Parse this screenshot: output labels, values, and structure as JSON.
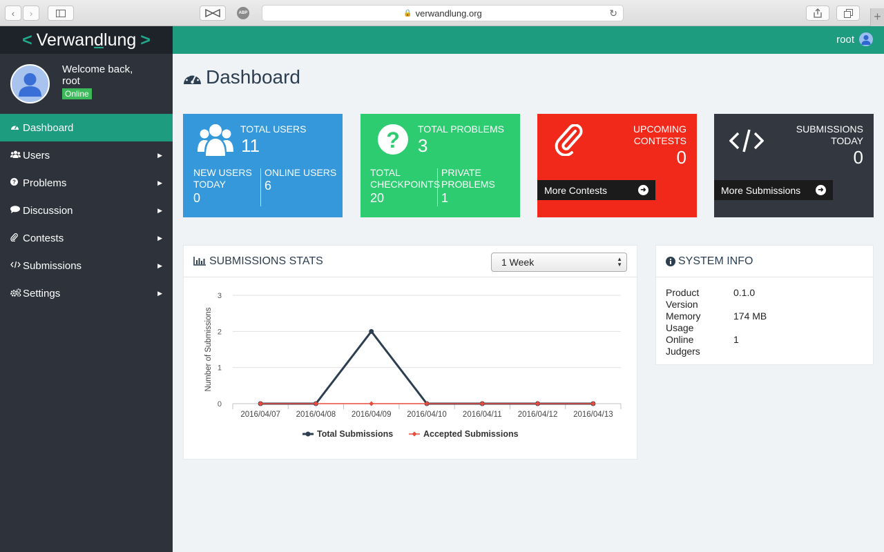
{
  "browser": {
    "url": "verwandlung.org"
  },
  "sidebar": {
    "logo": {
      "left": "<",
      "text_a": "Verwan",
      "text_u": "d",
      "text_b": "lung",
      "right": ">"
    },
    "welcome_line1": "Welcome back,",
    "welcome_line2": "root",
    "status": "Online",
    "items": [
      {
        "label": "Dashboard",
        "icon": "dashboard-icon",
        "active": true
      },
      {
        "label": "Users",
        "icon": "users-icon"
      },
      {
        "label": "Problems",
        "icon": "question-circle-icon"
      },
      {
        "label": "Discussion",
        "icon": "comment-icon"
      },
      {
        "label": "Contests",
        "icon": "paperclip-icon"
      },
      {
        "label": "Submissions",
        "icon": "code-icon"
      },
      {
        "label": "Settings",
        "icon": "gears-icon"
      }
    ]
  },
  "topbar": {
    "username": "root"
  },
  "page": {
    "title": "Dashboard"
  },
  "cards": {
    "users": {
      "title": "TOTAL USERS",
      "value": "11",
      "sub1_label_1": "NEW USERS",
      "sub1_label_2": "TODAY",
      "sub1_value": "0",
      "sub2_label": "ONLINE USERS",
      "sub2_value": "6"
    },
    "problems": {
      "title": "TOTAL PROBLEMS",
      "value": "3",
      "sub1_label_1": "TOTAL",
      "sub1_label_2": "CHECKPOINTS",
      "sub1_value": "20",
      "sub2_label_1": "PRIVATE",
      "sub2_label_2": "PROBLEMS",
      "sub2_value": "1"
    },
    "contests": {
      "title_1": "UPCOMING",
      "title_2": "CONTESTS",
      "value": "0",
      "button": "More Contests"
    },
    "submissions": {
      "title_1": "SUBMISSIONS",
      "title_2": "TODAY",
      "value": "0",
      "button": "More Submissions"
    }
  },
  "stats": {
    "title": "SUBMISSIONS STATS",
    "range_selected": "1 Week"
  },
  "chart_data": {
    "type": "line",
    "x": [
      "2016/04/07",
      "2016/04/08",
      "2016/04/09",
      "2016/04/10",
      "2016/04/11",
      "2016/04/12",
      "2016/04/13"
    ],
    "series": [
      {
        "name": "Total Submissions",
        "values": [
          0,
          0,
          2,
          0,
          0,
          0,
          0
        ],
        "color": "#2c3e50"
      },
      {
        "name": "Accepted Submissions",
        "values": [
          0,
          0,
          0,
          0,
          0,
          0,
          0
        ],
        "color": "#e74c3c"
      }
    ],
    "ylabel": "Number of Submissions",
    "yticks": [
      "0",
      "1",
      "2",
      "3"
    ],
    "ylim": [
      0,
      3
    ],
    "grid": true,
    "legend": "bottom"
  },
  "system_info": {
    "title": "SYSTEM INFO",
    "rows": [
      {
        "k1": "Product",
        "k2": "Version",
        "v": "0.1.0"
      },
      {
        "k1": "Memory",
        "k2": "Usage",
        "v": "174 MB"
      },
      {
        "k1": "Online",
        "k2": "Judgers",
        "v": "1"
      }
    ]
  }
}
